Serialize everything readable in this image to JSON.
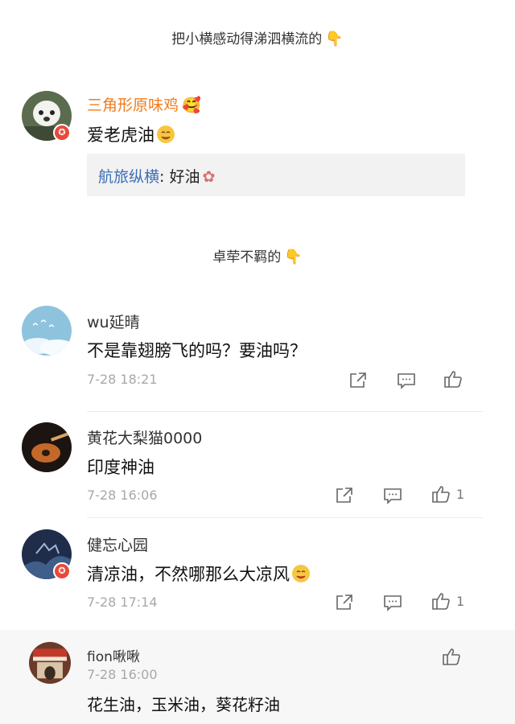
{
  "captions": {
    "first": "把小横感动得涕泗横流的",
    "second": "卓荦不羁的"
  },
  "comments": [
    {
      "username": "三角形原味鸡",
      "text": "爱老虎油",
      "reply": {
        "name": "航旅纵横",
        "sep": ": ",
        "text": "好油"
      }
    },
    {
      "username": "wu延晴",
      "text": "不是靠翅膀飞的吗？要油吗？",
      "time": "7-28 18:21"
    },
    {
      "username": "黄花大梨猫0000",
      "text": "印度神油",
      "time": "7-28 16:06",
      "likes": "1"
    },
    {
      "username": "健忘心园",
      "text": "清凉油，不然哪那么大凉风",
      "time": "7-28 17:14",
      "likes": "1"
    },
    {
      "username": "fion啾啾",
      "text": "花生油，玉米油，葵花籽油",
      "time": "7-28 16:00"
    }
  ],
  "icons": {
    "pointer": "point-down-emoji",
    "share": "share-icon",
    "comment": "comment-icon",
    "like": "thumbs-up-icon",
    "verified": "verified-badge"
  },
  "colors": {
    "username_highlight": "#f07b1d",
    "reply_name": "#3b6fb6",
    "badge": "#e8493a"
  }
}
